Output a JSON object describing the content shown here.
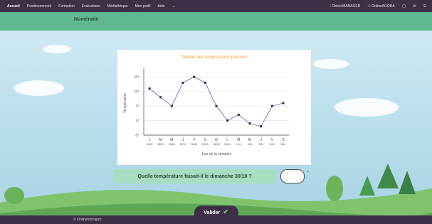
{
  "nav": {
    "items": [
      "Accueil",
      "Positionnement",
      "Formation",
      "Évaluations",
      "Médiathèque",
      "Mon profil",
      "Aide"
    ],
    "right": [
      "OnlineMANAGER",
      "OnlineAGORA"
    ]
  },
  "page": {
    "title": "Numératie"
  },
  "question": {
    "text": "Quelle température faisait-il le dimanche 30/10 ?",
    "answer_value": "",
    "unit": "°"
  },
  "validate": {
    "label": "Valider"
  },
  "footer": {
    "copyright": "© Onlineformapro"
  },
  "chart_data": {
    "type": "line",
    "title": "Tableau des températures par jours",
    "xlabel": "Jour de la semaine",
    "ylabel": "Température",
    "categories": [
      {
        "day": "L",
        "date": "24/10"
      },
      {
        "day": "M",
        "date": "25/10"
      },
      {
        "day": "M",
        "date": "26/10"
      },
      {
        "day": "J",
        "date": "27/10"
      },
      {
        "day": "V",
        "date": "28/10"
      },
      {
        "day": "S",
        "date": "29/10"
      },
      {
        "day": "D",
        "date": "30/10"
      },
      {
        "day": "L",
        "date": "31/10"
      },
      {
        "day": "M",
        "date": "1/11"
      },
      {
        "day": "M",
        "date": "2/11"
      },
      {
        "day": "J",
        "date": "3/11"
      },
      {
        "day": "V",
        "date": "4/11"
      },
      {
        "day": "S",
        "date": "5/11"
      }
    ],
    "values": [
      11,
      8,
      5,
      13,
      15,
      13,
      5,
      0,
      2,
      -1,
      -2,
      5,
      6
    ],
    "yticks": [
      15,
      10,
      5,
      0,
      -5
    ],
    "ytick_labels": [
      "15°",
      "10°",
      "5°",
      "0°",
      "-5°"
    ],
    "ylim": [
      -5,
      17
    ],
    "color": "#6f6fc9",
    "grid": true
  }
}
